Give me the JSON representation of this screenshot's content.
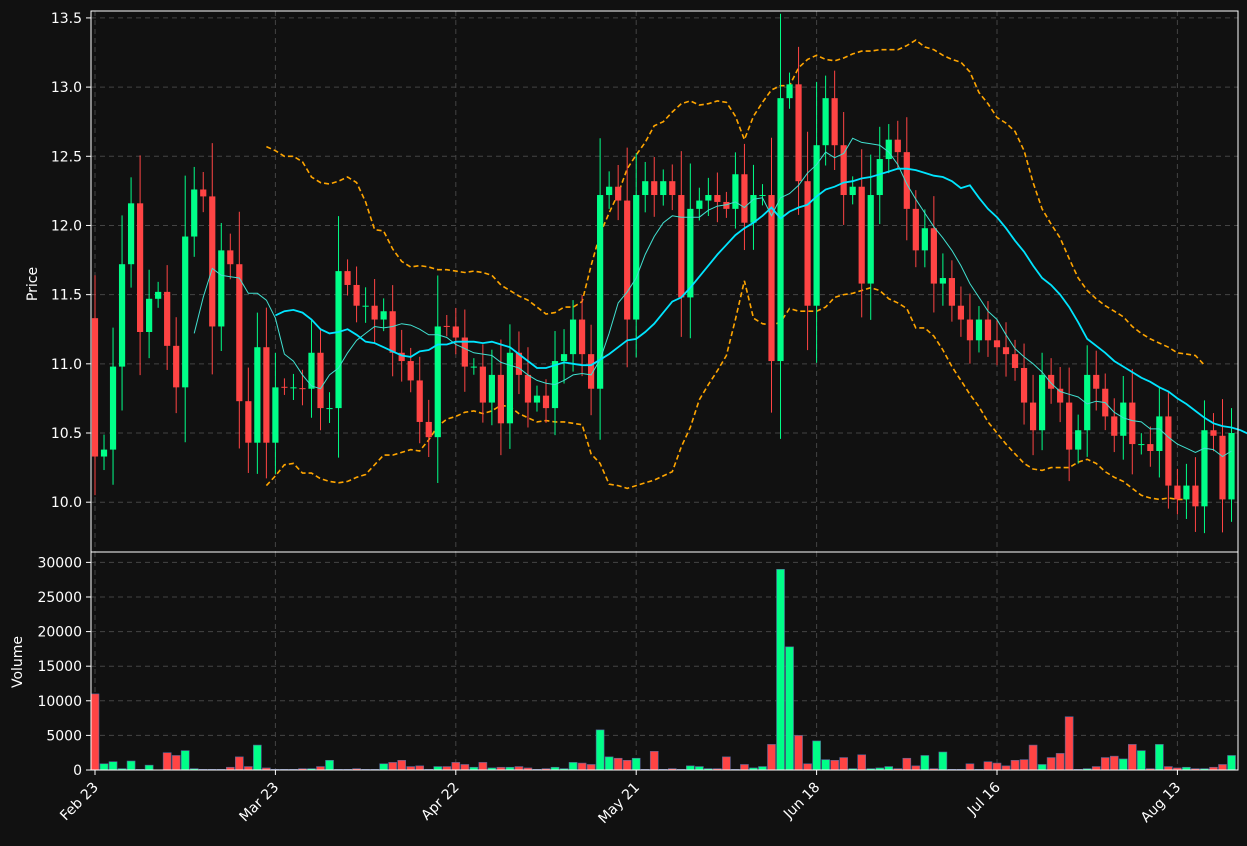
{
  "chart_data": {
    "type": "candlestick",
    "colors": {
      "background": "#111111",
      "up": "#00ff88",
      "down": "#ff4444",
      "grid": "#444444",
      "axis": "#ffffff",
      "ma_fast": "#40e0d0",
      "ma_slow": "#00e5ff",
      "bands": "#ffa500"
    },
    "price_panel": {
      "ylabel": "Price",
      "ylim": [
        9.64,
        13.55
      ],
      "yticks": [
        "10.0",
        "10.5",
        "11.0",
        "11.5",
        "12.0",
        "12.5",
        "13.0",
        "13.5"
      ],
      "grid": true
    },
    "volume_panel": {
      "ylabel": "Volume",
      "ylim": [
        0,
        31500
      ],
      "yticks": [
        "0",
        "5000",
        "10000",
        "15000",
        "20000",
        "25000",
        "30000"
      ],
      "grid": true
    },
    "x_ticks": [
      {
        "label": "Feb 23",
        "index": 0
      },
      {
        "label": "Mar 23",
        "index": 20
      },
      {
        "label": "Apr 22",
        "index": 40
      },
      {
        "label": "May 21",
        "index": 60
      },
      {
        "label": "Jun 18",
        "index": 80
      },
      {
        "label": "Jul 16",
        "index": 100
      },
      {
        "label": "Aug 13",
        "index": 120
      }
    ],
    "n_points": 127,
    "close": [
      10.33,
      10.38,
      10.98,
      11.72,
      12.16,
      11.23,
      11.47,
      11.52,
      11.13,
      10.83,
      11.92,
      12.26,
      12.21,
      11.27,
      11.82,
      11.72,
      10.73,
      10.43,
      11.12,
      10.43,
      10.83,
      10.83,
      10.83,
      10.82,
      11.08,
      10.68,
      10.68,
      11.67,
      11.57,
      11.42,
      11.42,
      11.32,
      11.38,
      11.08,
      11.02,
      10.88,
      10.58,
      10.47,
      11.27,
      11.27,
      11.19,
      10.98,
      10.98,
      10.72,
      10.92,
      10.57,
      11.08,
      10.92,
      10.72,
      10.77,
      10.68,
      11.02,
      11.07,
      11.32,
      11.07,
      10.82,
      12.22,
      12.28,
      12.18,
      11.32,
      12.22,
      12.32,
      12.22,
      12.32,
      12.22,
      11.48,
      12.12,
      12.18,
      12.22,
      12.17,
      12.12,
      12.37,
      12.02,
      12.22,
      12.22,
      11.02,
      12.92,
      13.02,
      12.32,
      11.42,
      12.58,
      12.92,
      12.58,
      12.22,
      12.28,
      11.58,
      12.22,
      12.48,
      12.62,
      12.53,
      12.12,
      11.82,
      11.98,
      11.58,
      11.62,
      11.42,
      11.32,
      11.17,
      11.32,
      11.17,
      11.12,
      11.07,
      10.97,
      10.72,
      10.52,
      10.92,
      10.82,
      10.72,
      10.38,
      10.52,
      10.92,
      10.82,
      10.62,
      10.48,
      10.72,
      10.42,
      10.42,
      10.37,
      10.62,
      10.12,
      10.02,
      10.12,
      9.97,
      10.52,
      10.48,
      10.02,
      10.5
    ],
    "volume": [
      11000,
      900,
      1200,
      200,
      1300,
      100,
      700,
      0,
      2500,
      2100,
      2800,
      200,
      100,
      100,
      100,
      400,
      1900,
      500,
      3600,
      300,
      100,
      100,
      100,
      200,
      200,
      500,
      1400,
      100,
      100,
      200,
      100,
      100,
      900,
      1100,
      1400,
      500,
      600,
      100,
      500,
      500,
      1100,
      800,
      400,
      1100,
      300,
      400,
      400,
      500,
      300,
      100,
      200,
      400,
      200,
      1100,
      1000,
      800,
      5800,
      1900,
      1700,
      1400,
      1700,
      100,
      2700,
      100,
      200,
      100,
      600,
      500,
      200,
      200,
      1900,
      100,
      800,
      300,
      500,
      3700,
      29000,
      17800,
      5000,
      900,
      4200,
      1500,
      1400,
      1800,
      200,
      2200,
      200,
      300,
      500,
      200,
      1700,
      600,
      2100,
      200,
      2600,
      100,
      100,
      900,
      100,
      1200,
      1000,
      600,
      1400,
      1500,
      3600,
      800,
      1800,
      2400,
      7700,
      100,
      200,
      500,
      1800,
      2000,
      1600,
      3700,
      2800,
      200,
      3700,
      500,
      300,
      400,
      200,
      200,
      400,
      800,
      2100
    ],
    "ma_fast": [
      null,
      null,
      null,
      null,
      null,
      null,
      null,
      null,
      null,
      null,
      null,
      11.22,
      11.48,
      11.69,
      11.64,
      11.63,
      11.62,
      11.51,
      11.51,
      11.46,
      11.33,
      11.07,
      11.02,
      10.92,
      10.84,
      10.82,
      10.92,
      10.97,
      11.08,
      11.17,
      11.22,
      11.27,
      11.26,
      11.27,
      11.29,
      11.28,
      11.25,
      11.21,
      11.21,
      11.19,
      11.14,
      11.11,
      11.08,
      11.07,
      11.06,
      11.01,
      10.99,
      10.97,
      10.92,
      10.88,
      10.86,
      10.85,
      10.88,
      10.92,
      10.93,
      10.92,
      11.03,
      11.22,
      11.44,
      11.52,
      11.62,
      11.79,
      11.92,
      12.02,
      12.07,
      12.06,
      12.06,
      12.06,
      12.11,
      12.14,
      12.15,
      12.17,
      12.13,
      12.19,
      12.2,
      12.07,
      12.2,
      12.23,
      12.29,
      12.38,
      12.44,
      12.53,
      12.49,
      12.52,
      12.63,
      12.6,
      12.59,
      12.58,
      12.53,
      12.44,
      12.3,
      12.19,
      12.09,
      11.99,
      11.91,
      11.82,
      11.71,
      11.58,
      11.48,
      11.38,
      11.32,
      11.21,
      11.11,
      11.05,
      11.0,
      10.94,
      10.86,
      10.8,
      10.78,
      10.76,
      10.71,
      10.73,
      10.72,
      10.65,
      10.61,
      10.59,
      10.58,
      10.53,
      10.53,
      10.47,
      10.42,
      10.39,
      10.36,
      10.39,
      10.38,
      10.33,
      10.37
    ],
    "ma_slow": [
      null,
      null,
      null,
      null,
      null,
      null,
      null,
      null,
      null,
      null,
      null,
      null,
      null,
      null,
      null,
      null,
      null,
      null,
      null,
      null,
      11.35,
      11.38,
      11.39,
      11.37,
      11.32,
      11.25,
      11.22,
      11.23,
      11.25,
      11.21,
      11.16,
      11.15,
      11.12,
      11.09,
      11.06,
      11.05,
      11.09,
      11.1,
      11.14,
      11.14,
      11.16,
      11.16,
      11.16,
      11.15,
      11.16,
      11.14,
      11.12,
      11.07,
      11.02,
      10.97,
      10.97,
      10.99,
      11.01,
      11.0,
      10.99,
      10.99,
      11.03,
      11.07,
      11.12,
      11.17,
      11.18,
      11.23,
      11.29,
      11.37,
      11.45,
      11.48,
      11.55,
      11.63,
      11.71,
      11.79,
      11.86,
      11.93,
      11.98,
      12.02,
      12.07,
      12.13,
      12.05,
      12.1,
      12.13,
      12.15,
      12.21,
      12.26,
      12.28,
      12.31,
      12.32,
      12.34,
      12.35,
      12.37,
      12.39,
      12.41,
      12.41,
      12.4,
      12.38,
      12.36,
      12.35,
      12.32,
      12.27,
      12.29,
      12.2,
      12.12,
      12.06,
      11.98,
      11.89,
      11.81,
      11.71,
      11.62,
      11.57,
      11.5,
      11.41,
      11.3,
      11.18,
      11.13,
      11.08,
      11.02,
      10.98,
      10.94,
      10.9,
      10.87,
      10.83,
      10.8,
      10.75,
      10.71,
      10.66,
      10.61,
      10.57,
      10.55,
      10.54,
      10.52,
      10.49
    ],
    "upper_band": [
      null,
      null,
      null,
      null,
      null,
      null,
      null,
      null,
      null,
      null,
      null,
      null,
      null,
      null,
      null,
      null,
      null,
      null,
      null,
      12.57,
      12.54,
      12.5,
      12.5,
      12.46,
      12.35,
      12.31,
      12.3,
      12.32,
      12.35,
      12.31,
      12.17,
      11.97,
      11.96,
      11.83,
      11.74,
      11.7,
      11.71,
      11.7,
      11.68,
      11.68,
      11.67,
      11.66,
      11.67,
      11.66,
      11.64,
      11.57,
      11.53,
      11.49,
      11.46,
      11.41,
      11.36,
      11.37,
      11.41,
      11.41,
      11.45,
      11.71,
      11.94,
      12.09,
      12.23,
      12.41,
      12.51,
      12.6,
      12.72,
      12.75,
      12.82,
      12.88,
      12.9,
      12.87,
      12.88,
      12.9,
      12.89,
      12.79,
      12.62,
      12.79,
      12.89,
      12.98,
      13.01,
      13.01,
      13.14,
      13.2,
      13.23,
      13.2,
      13.19,
      13.21,
      13.24,
      13.26,
      13.26,
      13.27,
      13.27,
      13.27,
      13.3,
      13.34,
      13.29,
      13.27,
      13.23,
      13.2,
      13.18,
      13.11,
      12.96,
      12.88,
      12.78,
      12.74,
      12.68,
      12.54,
      12.31,
      12.12,
      12.01,
      11.91,
      11.76,
      11.62,
      11.53,
      11.47,
      11.42,
      11.38,
      11.34,
      11.27,
      11.22,
      11.18,
      11.15,
      11.12,
      11.08,
      11.07,
      11.06,
      10.99
    ],
    "lower_band": [
      null,
      null,
      null,
      null,
      null,
      null,
      null,
      null,
      null,
      null,
      null,
      null,
      null,
      null,
      null,
      null,
      null,
      null,
      null,
      10.12,
      10.19,
      10.27,
      10.28,
      10.21,
      10.21,
      10.17,
      10.15,
      10.14,
      10.15,
      10.18,
      10.2,
      10.27,
      10.34,
      10.34,
      10.36,
      10.38,
      10.37,
      10.45,
      10.55,
      10.6,
      10.62,
      10.65,
      10.66,
      10.64,
      10.66,
      10.7,
      10.69,
      10.64,
      10.61,
      10.58,
      10.59,
      10.58,
      10.58,
      10.57,
      10.56,
      10.35,
      10.28,
      10.13,
      10.12,
      10.1,
      10.12,
      10.14,
      10.16,
      10.19,
      10.22,
      10.4,
      10.54,
      10.74,
      10.85,
      10.95,
      11.06,
      11.32,
      11.6,
      11.33,
      11.29,
      11.28,
      11.3,
      11.4,
      11.38,
      11.38,
      11.38,
      11.41,
      11.48,
      11.5,
      11.51,
      11.53,
      11.55,
      11.53,
      11.47,
      11.44,
      11.4,
      11.26,
      11.26,
      11.2,
      11.1,
      10.98,
      10.88,
      10.78,
      10.69,
      10.58,
      10.5,
      10.42,
      10.35,
      10.28,
      10.24,
      10.23,
      10.25,
      10.25,
      10.25,
      10.29,
      10.31,
      10.28,
      10.22,
      10.18,
      10.15,
      10.1,
      10.05,
      10.03,
      10.02,
      10.03,
      10.02,
      10.02
    ]
  }
}
